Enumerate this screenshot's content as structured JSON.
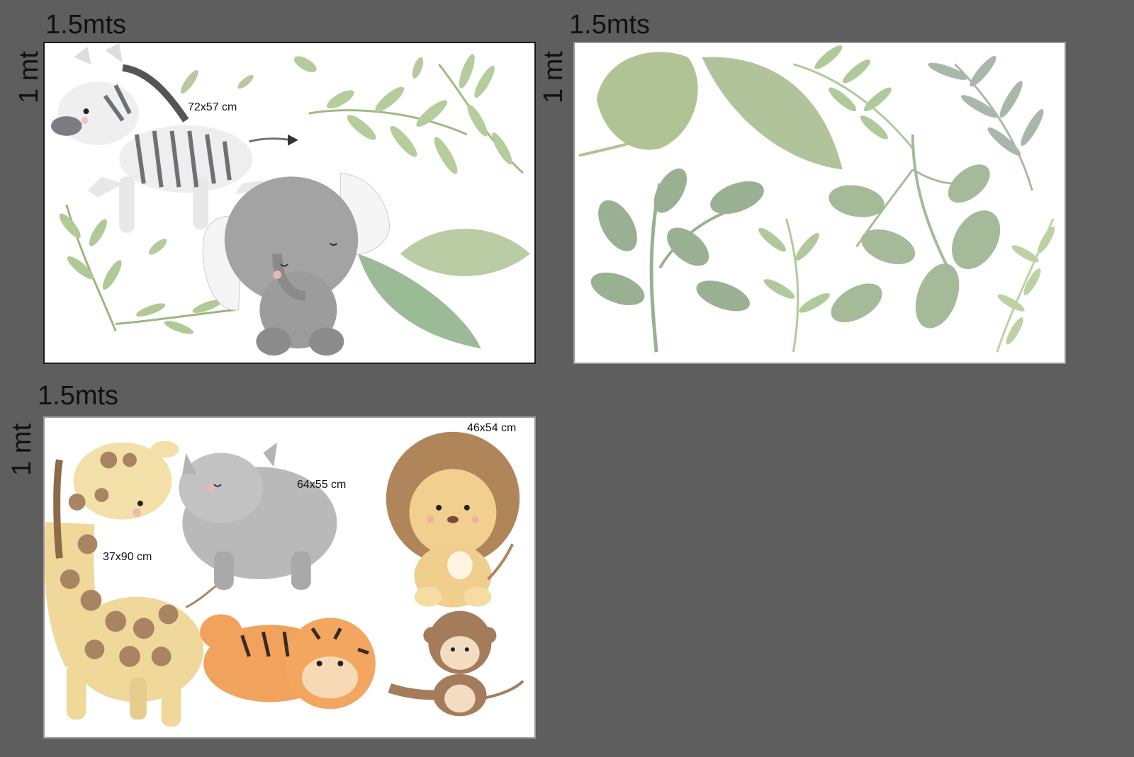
{
  "panels": [
    {
      "width_label": "1.5mts",
      "height_label": "1 mt",
      "size_labels": [
        "72x57 cm"
      ],
      "contents": [
        "zebra",
        "elephant",
        "leaves"
      ]
    },
    {
      "width_label": "1.5mts",
      "height_label": "1 mt",
      "size_labels": [],
      "contents": [
        "leaves"
      ]
    },
    {
      "width_label": "1.5mts",
      "height_label": "1 mt",
      "size_labels": [
        "64x55 cm",
        "46x54 cm",
        "37x90 cm"
      ],
      "contents": [
        "giraffe",
        "rhino",
        "lion",
        "tiger",
        "monkey"
      ]
    }
  ],
  "colors": {
    "background": "#5e5e5e",
    "panel": "#ffffff",
    "leaf_green": "#a9c48c",
    "leaf_sage": "#9fb38e",
    "gray_animal": "#9a9a9a"
  }
}
